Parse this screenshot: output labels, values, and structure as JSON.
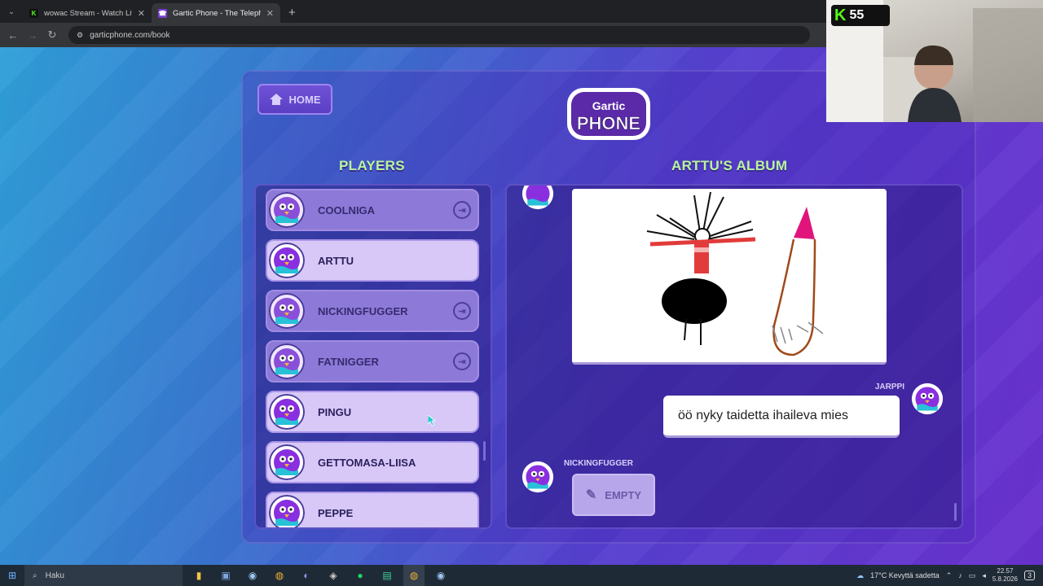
{
  "browser": {
    "tabs": [
      {
        "title": "wowac Stream - Watch Live on K",
        "favicon": "kick-icon",
        "active": false
      },
      {
        "title": "Gartic Phone - The Telephone G",
        "favicon": "gartic-icon",
        "active": true
      }
    ],
    "url": "garticphone.com/book"
  },
  "game": {
    "home_label": "HOME",
    "logo_top": "Gartic",
    "logo_main": "PHONE",
    "players_header": "PLAYERS",
    "album_header": "ARTTU'S ALBUM",
    "players": [
      {
        "name": "COOLNIGA",
        "online": false
      },
      {
        "name": "ARTTU",
        "online": true
      },
      {
        "name": "NICKINGFUGGER",
        "online": false
      },
      {
        "name": "FATNIGGER",
        "online": false
      },
      {
        "name": "PINGU",
        "online": true
      },
      {
        "name": "GETTOMASA-LIISA",
        "online": true
      },
      {
        "name": "PEPPE",
        "online": true
      }
    ],
    "album": {
      "guess_author": "JARPPI",
      "guess_text": "öö nyky taidetta ihaileva mies",
      "next_author": "NICKINGFUGGER",
      "empty_label": "EMPTY"
    }
  },
  "stream_overlay": {
    "viewers": "55"
  },
  "taskbar": {
    "search_placeholder": "Haku",
    "weather": "17°C  Kevyttä sadetta",
    "time": "22.57",
    "date": "5.8.2026",
    "notifications": "3"
  },
  "colors": {
    "accent_green": "#b8f59b",
    "panel_purple": "#5a3fc4"
  }
}
